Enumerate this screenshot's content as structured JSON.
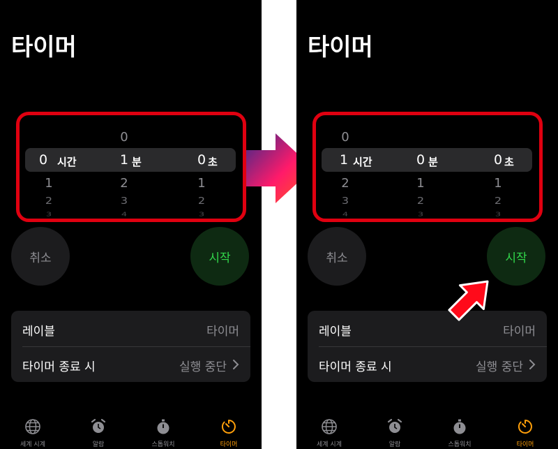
{
  "left_screen": {
    "title": "타이머",
    "picker": {
      "hours": {
        "above": "",
        "selected": "0",
        "below": [
          "1",
          "2",
          "3"
        ],
        "unit": "시간"
      },
      "minutes": {
        "above": "0",
        "selected": "1",
        "below": [
          "2",
          "3",
          "4"
        ],
        "unit": "분"
      },
      "seconds": {
        "above": "",
        "selected": "0",
        "below": [
          "1",
          "2",
          "3"
        ],
        "unit": "초"
      }
    },
    "cancel_label": "취소",
    "start_label": "시작",
    "label_row": {
      "key": "레이블",
      "value": "타이머"
    },
    "end_row": {
      "key": "타이머 종료 시",
      "value": "실행 중단"
    }
  },
  "right_screen": {
    "title": "타이머",
    "picker": {
      "hours": {
        "above": "0",
        "selected": "1",
        "below": [
          "2",
          "3",
          "4"
        ],
        "unit": "시간"
      },
      "minutes": {
        "above": "",
        "selected": "0",
        "below": [
          "1",
          "2",
          "3"
        ],
        "unit": "분"
      },
      "seconds": {
        "above": "",
        "selected": "0",
        "below": [
          "1",
          "2",
          "3"
        ],
        "unit": "초"
      }
    },
    "cancel_label": "취소",
    "start_label": "시작",
    "label_row": {
      "key": "레이블",
      "value": "타이머"
    },
    "end_row": {
      "key": "타이머 종료 시",
      "value": "실행 중단"
    }
  },
  "tabs": [
    {
      "label": "세계 시계",
      "icon": "globe-icon",
      "active": false
    },
    {
      "label": "알람",
      "icon": "alarm-clock-icon",
      "active": false
    },
    {
      "label": "스톱워치",
      "icon": "stopwatch-icon",
      "active": false
    },
    {
      "label": "타이머",
      "icon": "timer-icon",
      "active": true
    }
  ],
  "colors": {
    "highlight": "#e00010",
    "start_green": "#32d74b",
    "tab_active": "#ff9f0a",
    "arrow_gradient": [
      "#3a2a8a",
      "#ff1a6a",
      "#ff5a1a"
    ]
  }
}
